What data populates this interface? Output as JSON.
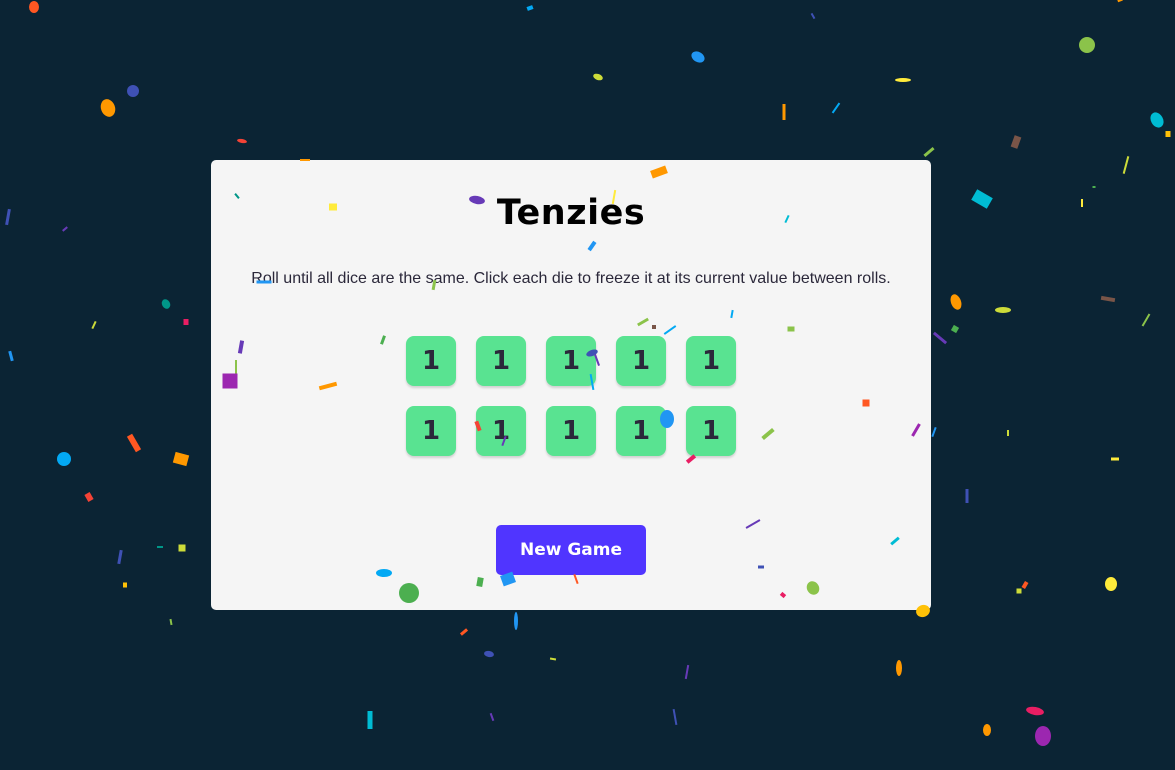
{
  "game": {
    "title": "Tenzies",
    "instructions": "Roll until all dice are the same. Click each die to freeze it at its current value between rolls.",
    "dice": [
      "1",
      "1",
      "1",
      "1",
      "1",
      "1",
      "1",
      "1",
      "1",
      "1"
    ],
    "new_game_label": "New Game"
  },
  "colors": {
    "background": "#0b2434",
    "card": "#f5f5f5",
    "die_held": "#59e391",
    "button": "#5035ff"
  }
}
